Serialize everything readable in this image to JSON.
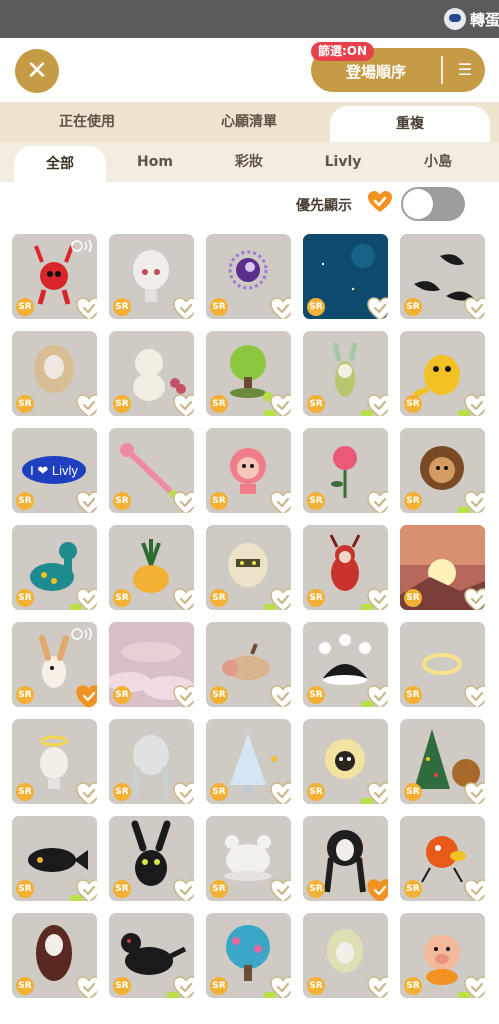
{
  "topbar": {
    "title": "轉蛋",
    "icon": "mascot-icon"
  },
  "header": {
    "close_icon": "close-icon",
    "sort_label": "登場順序",
    "filter_badge": "篩選:ON",
    "sort_icon": "sort-icon"
  },
  "tabs_primary": [
    {
      "label": "正在使用",
      "active": false
    },
    {
      "label": "心願清單",
      "active": false
    },
    {
      "label": "重複",
      "active": true
    }
  ],
  "tabs_secondary": [
    {
      "label": "全部",
      "active": true
    },
    {
      "label": "Hom",
      "active": false
    },
    {
      "label": "彩妝",
      "active": false
    },
    {
      "label": "Livly",
      "active": false
    },
    {
      "label": "小島",
      "active": false
    }
  ],
  "priority": {
    "label": "優先顯示",
    "toggle_on": false
  },
  "grid": {
    "rarity_label": "SR",
    "items": [
      {
        "name": "red-deer-livly",
        "bg": "#cfcac4",
        "art": "red-creature",
        "heart_active": false,
        "green": false,
        "sound": true
      },
      {
        "name": "white-head",
        "bg": "#cfcac4",
        "art": "white-head",
        "heart_active": false,
        "green": false,
        "sound": false
      },
      {
        "name": "purple-moon-orb",
        "bg": "#cfcac4",
        "art": "purple-orb",
        "heart_active": false,
        "green": false,
        "sound": false
      },
      {
        "name": "night-sky",
        "bg": "#0d4a6e",
        "art": "night-sky",
        "heart_active": false,
        "green": false,
        "sound": false
      },
      {
        "name": "black-feathers",
        "bg": "#cfcac4",
        "art": "feathers",
        "heart_active": false,
        "green": false,
        "sound": false
      },
      {
        "name": "blonde-curls",
        "bg": "#cfcac4",
        "art": "blonde-hair",
        "heart_active": false,
        "green": false,
        "sound": false
      },
      {
        "name": "teddy-bear",
        "bg": "#cfcac4",
        "art": "teddy",
        "heart_active": false,
        "green": false,
        "sound": false
      },
      {
        "name": "green-tree",
        "bg": "#cfcac4",
        "art": "tree",
        "heart_active": false,
        "green": true,
        "sound": false
      },
      {
        "name": "bunny-plant",
        "bg": "#cfcac4",
        "art": "bunny-plant",
        "heart_active": false,
        "green": true,
        "sound": false
      },
      {
        "name": "yellow-livly",
        "bg": "#cfcac4",
        "art": "yellow-creature",
        "heart_active": false,
        "green": true,
        "sound": false
      },
      {
        "name": "livly-sign",
        "bg": "#cfcac4",
        "art": "livly-sign",
        "heart_active": false,
        "green": false,
        "sound": false
      },
      {
        "name": "pink-flower-wand",
        "bg": "#cfcac4",
        "art": "wand",
        "heart_active": false,
        "green": false,
        "sound": false
      },
      {
        "name": "pink-heart-livly",
        "bg": "#cfcac4",
        "art": "pink-creature",
        "heart_active": false,
        "green": false,
        "sound": false
      },
      {
        "name": "rose",
        "bg": "#cfcac4",
        "art": "rose",
        "heart_active": false,
        "green": false,
        "sound": false
      },
      {
        "name": "lion-livly",
        "bg": "#cfcac4",
        "art": "lion",
        "heart_active": false,
        "green": true,
        "sound": false
      },
      {
        "name": "teal-dino",
        "bg": "#cfcac4",
        "art": "teal-dino",
        "heart_active": false,
        "green": true,
        "sound": false
      },
      {
        "name": "pineapple",
        "bg": "#cfcac4",
        "art": "pineapple",
        "heart_active": false,
        "green": false,
        "sound": false
      },
      {
        "name": "mummy-livly",
        "bg": "#cfcac4",
        "art": "mummy",
        "heart_active": false,
        "green": true,
        "sound": false
      },
      {
        "name": "red-dragon-livly",
        "bg": "#cfcac4",
        "art": "red-dragon",
        "heart_active": false,
        "green": true,
        "sound": false
      },
      {
        "name": "sunset-mountain",
        "bg": "#b8685a",
        "art": "sunset",
        "heart_active": false,
        "green": false,
        "sound": false
      },
      {
        "name": "bunny-livly",
        "bg": "#cfcac4",
        "art": "bunny",
        "heart_active": true,
        "green": false,
        "sound": true
      },
      {
        "name": "pink-clouds",
        "bg": "#d8c0c8",
        "art": "clouds",
        "heart_active": false,
        "green": false,
        "sound": false
      },
      {
        "name": "boar-livly",
        "bg": "#cfcac4",
        "art": "boar",
        "heart_active": false,
        "green": false,
        "sound": false
      },
      {
        "name": "jester-hat",
        "bg": "#cfcac4",
        "art": "jester-hat",
        "heart_active": false,
        "green": true,
        "sound": false
      },
      {
        "name": "halo",
        "bg": "#cfcac4",
        "art": "halo",
        "heart_active": false,
        "green": false,
        "sound": false
      },
      {
        "name": "angel-head",
        "bg": "#cfcac4",
        "art": "angel-head",
        "heart_active": false,
        "green": false,
        "sound": false
      },
      {
        "name": "pale-braids",
        "bg": "#cfcac4",
        "art": "braids",
        "heart_active": false,
        "green": false,
        "sound": false
      },
      {
        "name": "snow-tree",
        "bg": "#cfcac4",
        "art": "snow-tree",
        "heart_active": false,
        "green": false,
        "sound": false
      },
      {
        "name": "sheep-livly",
        "bg": "#cfcac4",
        "art": "sheep",
        "heart_active": false,
        "green": true,
        "sound": false
      },
      {
        "name": "christmas-tree",
        "bg": "#cfcac4",
        "art": "xmas-tree",
        "heart_active": false,
        "green": false,
        "sound": false
      },
      {
        "name": "black-fish",
        "bg": "#cfcac4",
        "art": "black-fish",
        "heart_active": false,
        "green": true,
        "sound": false
      },
      {
        "name": "black-bunny",
        "bg": "#cfcac4",
        "art": "black-bunny",
        "heart_active": false,
        "green": false,
        "sound": false
      },
      {
        "name": "fluffy-hat",
        "bg": "#cfcac4",
        "art": "white-hat",
        "heart_active": false,
        "green": false,
        "sound": false
      },
      {
        "name": "black-braids",
        "bg": "#cfcac4",
        "art": "black-braids",
        "heart_active": true,
        "green": false,
        "sound": false
      },
      {
        "name": "orange-bird",
        "bg": "#cfcac4",
        "art": "orange-bird",
        "heart_active": false,
        "green": false,
        "sound": false
      },
      {
        "name": "long-brown-hair",
        "bg": "#cfcac4",
        "art": "brown-hair",
        "heart_active": false,
        "green": false,
        "sound": false
      },
      {
        "name": "black-dragon",
        "bg": "#cfcac4",
        "art": "black-dragon",
        "heart_active": false,
        "green": true,
        "sound": false
      },
      {
        "name": "blue-flower-tree",
        "bg": "#cfcac4",
        "art": "blue-tree",
        "heart_active": false,
        "green": true,
        "sound": false
      },
      {
        "name": "green-short-hair",
        "bg": "#cfcac4",
        "art": "green-hair",
        "heart_active": false,
        "green": false,
        "sound": false
      },
      {
        "name": "pig-livly",
        "bg": "#cfcac4",
        "art": "pig",
        "heart_active": false,
        "green": true,
        "sound": false
      }
    ]
  },
  "colors": {
    "accent": "#c59b45",
    "badge": "#e8404b",
    "heart_active": "#f29222",
    "heart_inactive": "#ffffff",
    "toggle_off": "#9e9e9e"
  }
}
